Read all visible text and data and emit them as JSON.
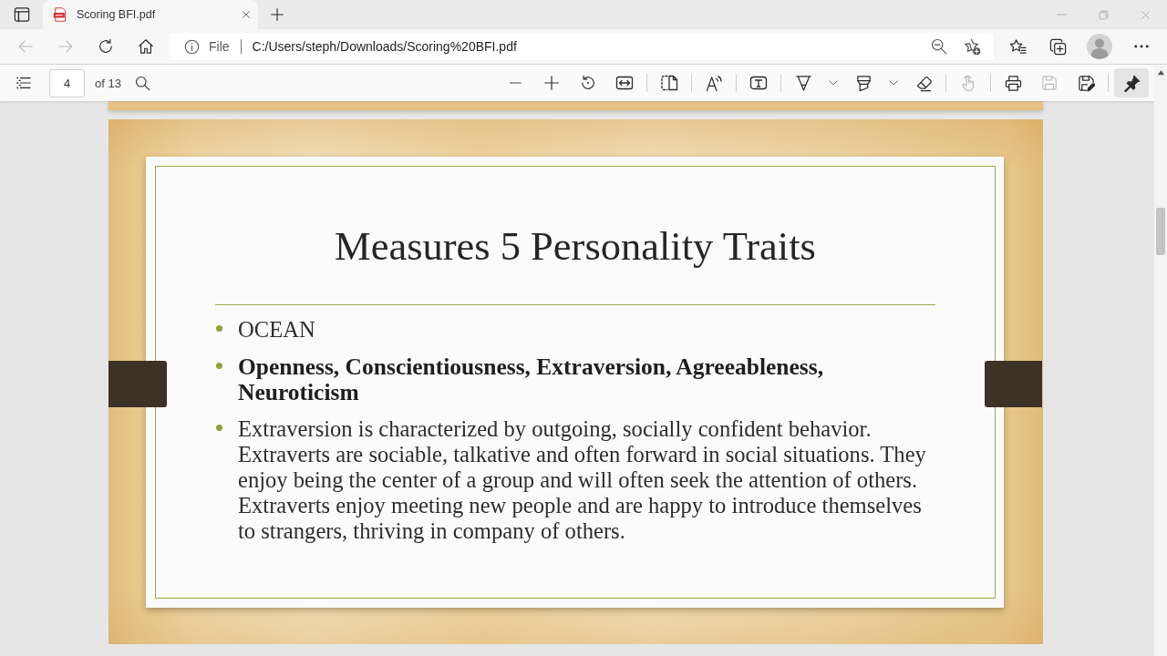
{
  "tabs": [
    {
      "title": "Scoring BFI.pdf",
      "selected": true
    }
  ],
  "navigation": {
    "back": {
      "disabled": true
    },
    "forward": {
      "disabled": true
    }
  },
  "address_bar": {
    "scheme": "File",
    "url": "C:/Users/steph/Downloads/Scoring%20BFI.pdf"
  },
  "pdf_toolbar": {
    "page_number": "4",
    "page_count": "of 13",
    "touch_input": {
      "disabled": true
    },
    "save": {
      "disabled": true
    },
    "save_as": {
      "disabled": false
    },
    "pin": {
      "on": true
    }
  },
  "slide": {
    "title": "Measures 5 Personality Traits",
    "bullets": [
      {
        "kind": "plain",
        "text": "OCEAN"
      },
      {
        "kind": "bold",
        "text": "Openness, Conscientiousness, Extraversion, Agreeableness, Neuroticism"
      },
      {
        "kind": "plain",
        "text": "Extraversion is characterized by outgoing, socially confident behavior. Extraverts are sociable, talkative and often forward in social situations. They enjoy being the center of a group and will often seek the attention of others. Extraverts enjoy meeting new people and are happy to introduce themselves to strangers, thriving in company of others."
      }
    ]
  }
}
